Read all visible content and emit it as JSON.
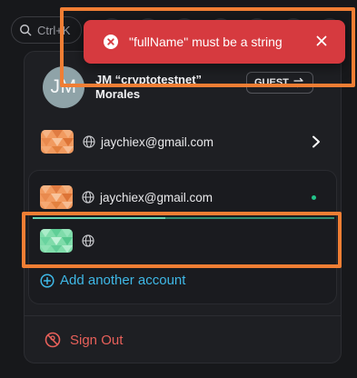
{
  "topbar": {
    "search_shortcut": "Ctrl+K"
  },
  "profile": {
    "initials": "JM",
    "name": "JM “cryptotestnet” Morales",
    "badge": "GUEST"
  },
  "accounts": [
    {
      "email": "jaychiex@gmail.com",
      "has_chevron": true
    },
    {
      "email": "jaychiex@gmail.com",
      "active": true
    },
    {
      "email": ""
    }
  ],
  "switch_progress": 0.44,
  "add_account_label": "Add another account",
  "sign_out_label": "Sign Out",
  "toast": {
    "message": "\"fullName\" must be a string",
    "type": "error"
  },
  "colors": {
    "toast_bg": "#d63a3f",
    "accent_link": "#3fb8e6",
    "danger": "#e8605a",
    "active_dot": "#22c48a",
    "highlight": "#f07e34"
  }
}
